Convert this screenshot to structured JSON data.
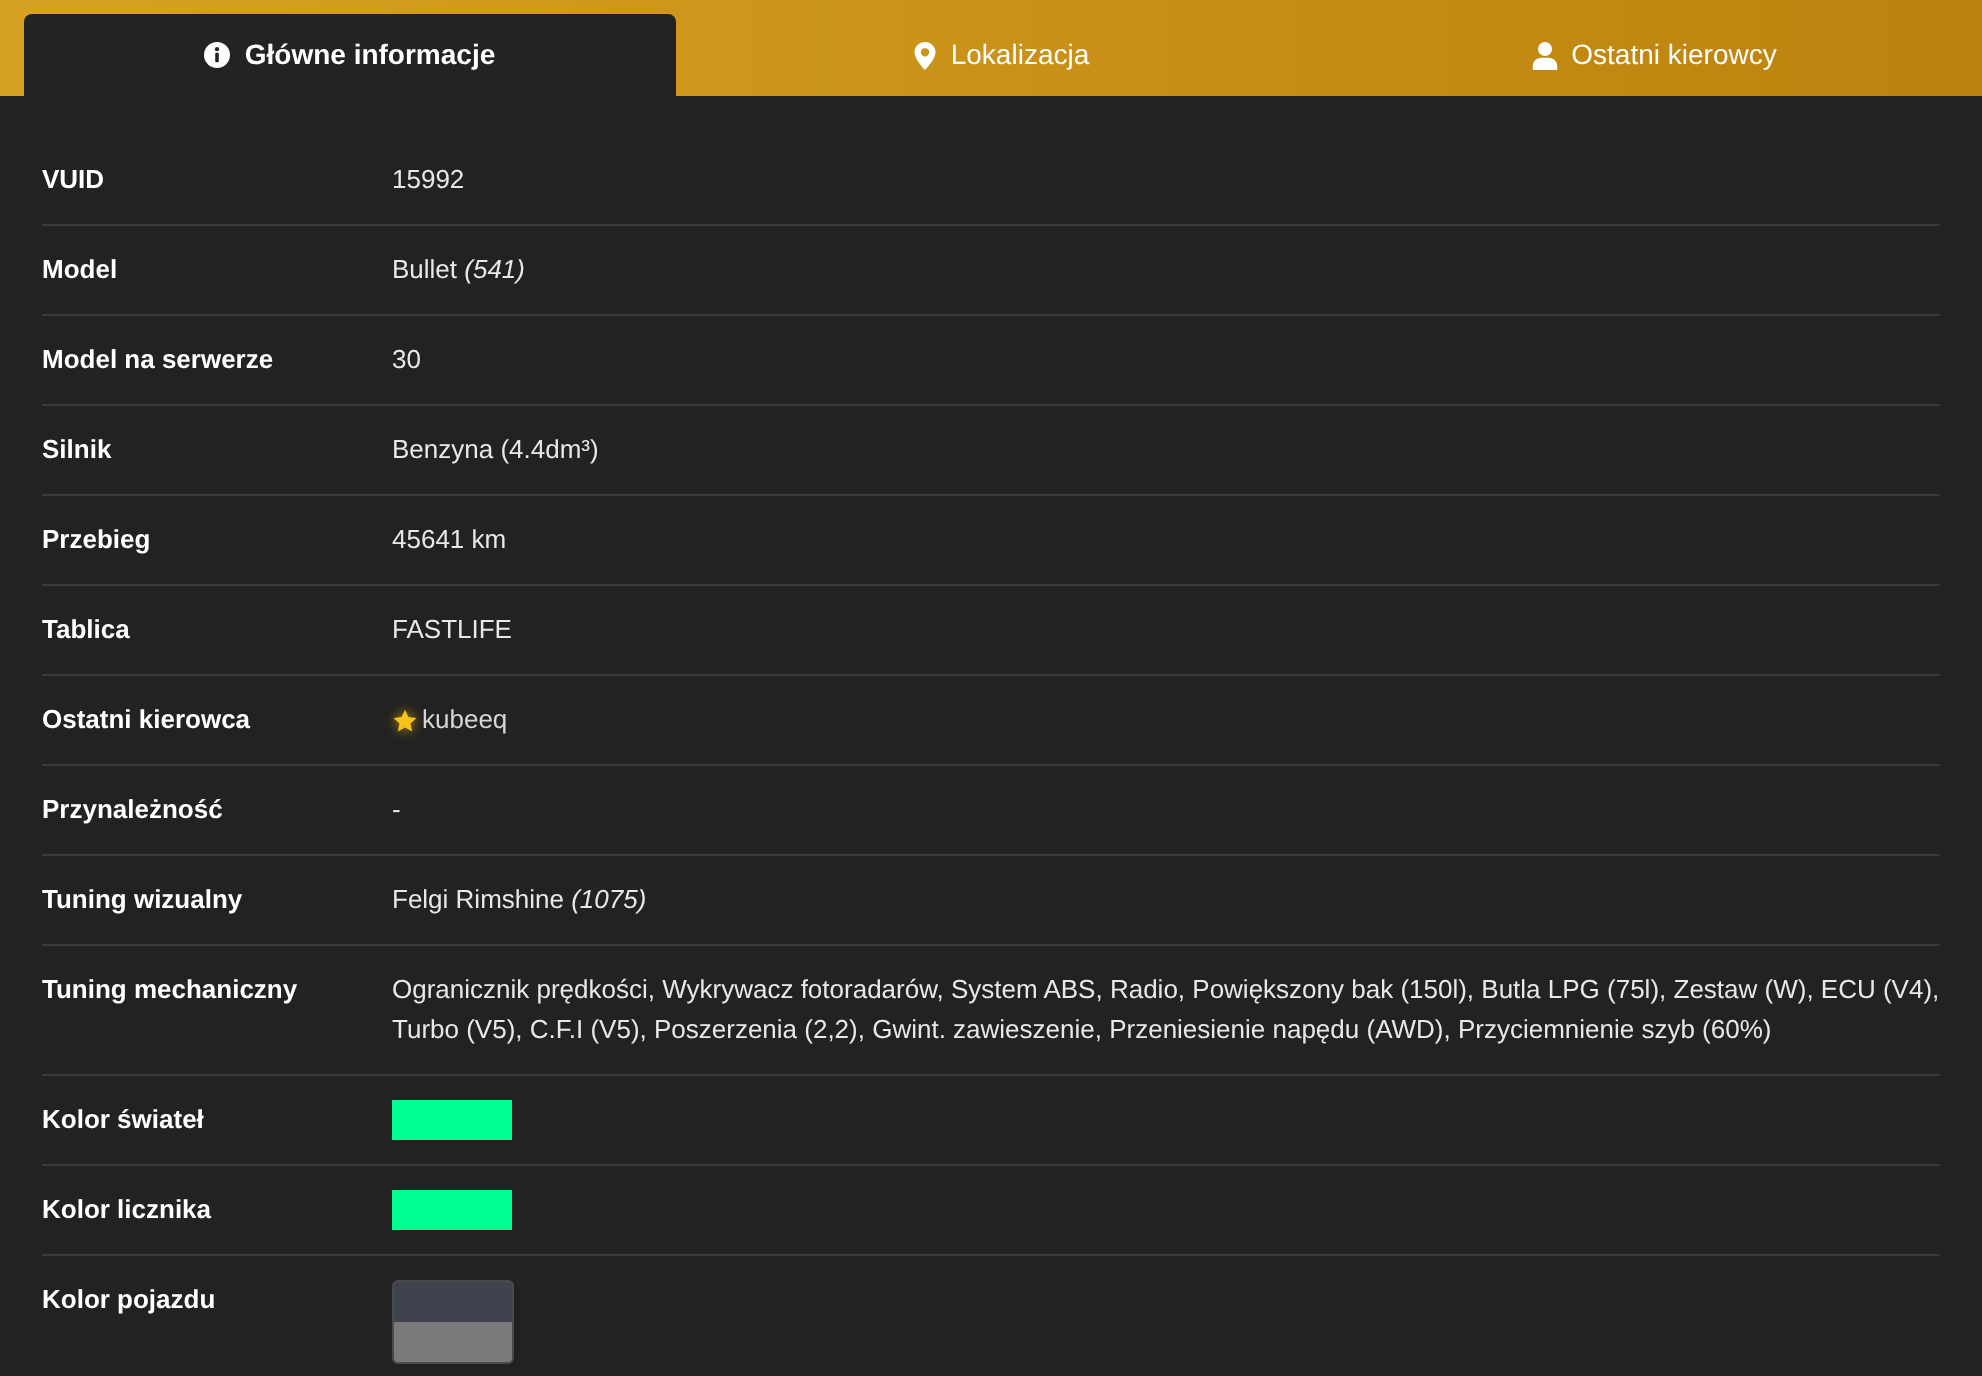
{
  "tabs": [
    {
      "label": "Główne informacje",
      "selected": true
    },
    {
      "label": "Lokalizacja",
      "selected": false
    },
    {
      "label": "Ostatni kierowcy",
      "selected": false
    }
  ],
  "rows": [
    {
      "label": "VUID",
      "kind": "text",
      "value": "15992"
    },
    {
      "label": "Model",
      "kind": "text",
      "value": "Bullet *(541)*"
    },
    {
      "label": "Model na serwerze",
      "kind": "text",
      "value": "30"
    },
    {
      "label": "Silnik",
      "kind": "text",
      "value": "Benzyna (4.4dm³)"
    },
    {
      "label": "Przebieg",
      "kind": "text",
      "value": "45641 km"
    },
    {
      "label": "Tablica",
      "kind": "text",
      "value": "FASTLIFE"
    },
    {
      "label": "Ostatni kierowca",
      "kind": "driver",
      "value": "kubeeq"
    },
    {
      "label": "Przynależność",
      "kind": "text",
      "value": "-"
    },
    {
      "label": "Tuning wizualny",
      "kind": "text",
      "value": "Felgi Rimshine *(1075)*"
    },
    {
      "label": "Tuning mechaniczny",
      "kind": "text",
      "value": "Ogranicznik prędkości, Wykrywacz fotoradarów, System ABS, Radio, Powiększony bak (150l), Butla LPG (75l), Zestaw (W), ECU (V4), Turbo (V5), C.F.I (V5), Poszerzenia (2,2), Gwint. zawieszenie, Przeniesienie napędu (AWD), Przyciemnienie szyb (60%)"
    },
    {
      "label": "Kolor świateł",
      "kind": "color",
      "color": "#00ff91"
    },
    {
      "label": "Kolor licznika",
      "kind": "color",
      "color": "#00ff91"
    },
    {
      "label": "Kolor pojazdu",
      "kind": "colors",
      "colors": [
        {
          "color": "#3f4350"
        },
        {
          "color": "#7a7a7a"
        }
      ]
    }
  ]
}
